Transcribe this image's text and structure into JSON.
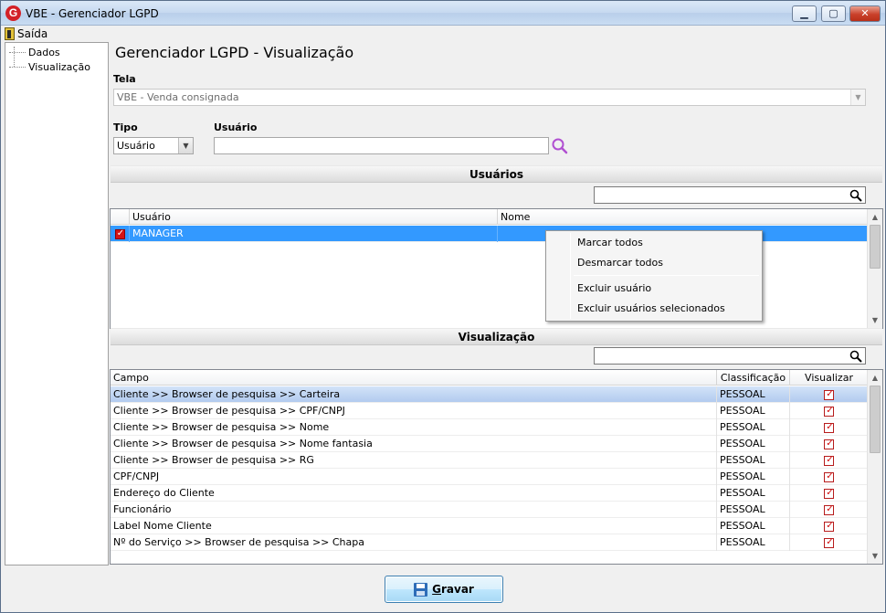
{
  "window": {
    "title": "VBE - Gerenciador LGPD",
    "app_icon_letter": "G",
    "minimize": "▁",
    "maximize": "▢",
    "close": "✕"
  },
  "menu": {
    "exit_label": "Saída"
  },
  "tree": {
    "items": [
      {
        "label": "Dados"
      },
      {
        "label": "Visualização"
      }
    ]
  },
  "page": {
    "title": "Gerenciador LGPD - Visualização"
  },
  "form": {
    "tela_label": "Tela",
    "tela_value": "VBE - Venda consignada",
    "tipo_label": "Tipo",
    "tipo_value": "Usuário",
    "usuario_label": "Usuário",
    "usuario_value": ""
  },
  "users_section": {
    "header": "Usuários",
    "filter_value": "",
    "columns": [
      "Usuário",
      "Nome"
    ],
    "rows": [
      {
        "checked": true,
        "usuario": "MANAGER",
        "nome": ""
      }
    ]
  },
  "context_menu": {
    "items": [
      "Marcar todos",
      "Desmarcar todos",
      "Excluir usuário",
      "Excluir usuários selecionados"
    ]
  },
  "view_section": {
    "header": "Visualização",
    "filter_value": "",
    "columns": [
      "Campo",
      "Classificação",
      "Visualizar"
    ],
    "rows": [
      {
        "campo": "Cliente >> Browser de pesquisa >> Carteira",
        "classificacao": "PESSOAL",
        "visualizar": true
      },
      {
        "campo": "Cliente >> Browser de pesquisa >> CPF/CNPJ",
        "classificacao": "PESSOAL",
        "visualizar": true
      },
      {
        "campo": "Cliente >> Browser de pesquisa >> Nome",
        "classificacao": "PESSOAL",
        "visualizar": true
      },
      {
        "campo": "Cliente >> Browser de pesquisa >> Nome fantasia",
        "classificacao": "PESSOAL",
        "visualizar": true
      },
      {
        "campo": "Cliente >> Browser de pesquisa >> RG",
        "classificacao": "PESSOAL",
        "visualizar": true
      },
      {
        "campo": "CPF/CNPJ",
        "classificacao": "PESSOAL",
        "visualizar": true
      },
      {
        "campo": "Endereço do Cliente",
        "classificacao": "PESSOAL",
        "visualizar": true
      },
      {
        "campo": "Funcionário",
        "classificacao": "PESSOAL",
        "visualizar": true
      },
      {
        "campo": "Label Nome Cliente",
        "classificacao": "PESSOAL",
        "visualizar": true
      },
      {
        "campo": "Nº do Serviço >> Browser de pesquisa >> Chapa",
        "classificacao": "PESSOAL",
        "visualizar": true
      }
    ]
  },
  "footer": {
    "save_label": "Gravar",
    "save_mnemonic": "G"
  },
  "colors": {
    "selection": "#3399ff",
    "focus_row": "#c6d8f2",
    "check_red": "#d41414",
    "search_accent": "#b04fd1"
  }
}
